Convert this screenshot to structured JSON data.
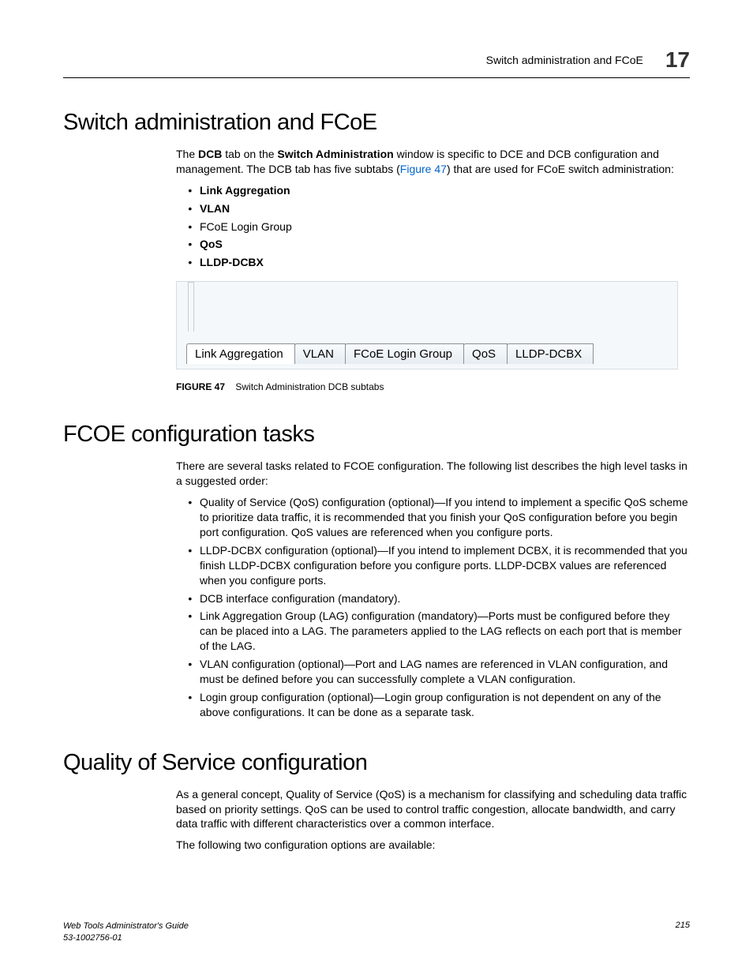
{
  "header": {
    "running_title": "Switch administration and FCoE",
    "chapter_number": "17"
  },
  "section1": {
    "title": "Switch administration and FCoE",
    "intro_pre": "The ",
    "intro_bold1": "DCB",
    "intro_mid1": " tab on the ",
    "intro_bold2": "Switch Administration",
    "intro_mid2": " window is specific to DCE and DCB configuration and management. The DCB tab has five subtabs (",
    "intro_link": "Figure 47",
    "intro_post": ") that are used for FCoE switch administration:",
    "bullets": [
      "Link Aggregation",
      "VLAN",
      "FCoE Login Group",
      "QoS",
      "LLDP-DCBX"
    ],
    "bold_flags": [
      true,
      true,
      false,
      true,
      true
    ],
    "figure": {
      "tabs": [
        "Link Aggregation",
        "VLAN",
        "FCoE Login Group",
        "QoS",
        "LLDP-DCBX"
      ],
      "caption_label": "FIGURE 47",
      "caption_text": "Switch Administration DCB subtabs"
    }
  },
  "section2": {
    "title": "FCOE configuration tasks",
    "intro": "There are several tasks related to FCOE configuration. The following list describes the high level tasks in a suggested order:",
    "bullets": [
      "Quality of Service (QoS) configuration (optional)—If you intend to implement a specific QoS scheme to prioritize data traffic, it is recommended that you finish your QoS configuration before you begin port configuration. QoS values are referenced when you configure ports.",
      "LLDP-DCBX configuration (optional)—If you intend to implement DCBX, it is recommended that you finish LLDP-DCBX configuration before you configure ports. LLDP-DCBX values are referenced when you configure ports.",
      "DCB interface configuration (mandatory).",
      "Link Aggregation Group (LAG) configuration (mandatory)—Ports must be configured before they can be placed into a LAG. The parameters applied to the LAG reflects on each port that is member of the LAG.",
      "VLAN configuration (optional)—Port and LAG names are referenced in VLAN configuration, and must be defined before you can successfully complete a VLAN configuration.",
      "Login group configuration (optional)—Login group configuration is not dependent on any of the above configurations. It can be done as a separate task."
    ]
  },
  "section3": {
    "title": "Quality of Service configuration",
    "p1": "As a general concept, Quality of Service (QoS) is a mechanism for classifying and scheduling data traffic based on priority settings. QoS can be used to control traffic congestion, allocate bandwidth, and carry data traffic with different characteristics over a common interface.",
    "p2": "The following two configuration options are available:"
  },
  "footer": {
    "guide": "Web Tools Administrator's Guide",
    "docnum": "53-1002756-01",
    "pagenum": "215"
  }
}
